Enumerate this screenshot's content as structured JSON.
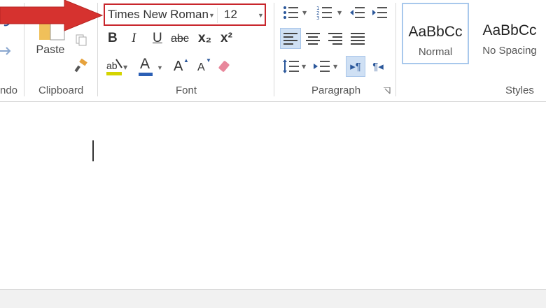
{
  "clipboard": {
    "paste_label": "Paste",
    "group_label": "Clipboard"
  },
  "undo": {
    "group_label": "ndo"
  },
  "font": {
    "name": "Times New Roman",
    "size": "12",
    "group_label": "Font",
    "bold": "B",
    "italic": "I",
    "underline": "U",
    "strikethrough": "abc",
    "subscript": "x₂",
    "superscript": "x²",
    "font_color_letter": "A",
    "grow": "A",
    "shrink": "A"
  },
  "paragraph": {
    "group_label": "Paragraph"
  },
  "styles": {
    "group_label": "Styles",
    "items": [
      {
        "sample": "AaBbCc",
        "name": "Normal"
      },
      {
        "sample": "AaBbCc",
        "name": "No Spacing"
      }
    ]
  },
  "colors": {
    "highlight": "#d4d400",
    "font_color": "#2b5fb5",
    "red_outline": "#c8262c",
    "arrow_red": "#d6322f",
    "accent_blue": "#2b579a"
  }
}
